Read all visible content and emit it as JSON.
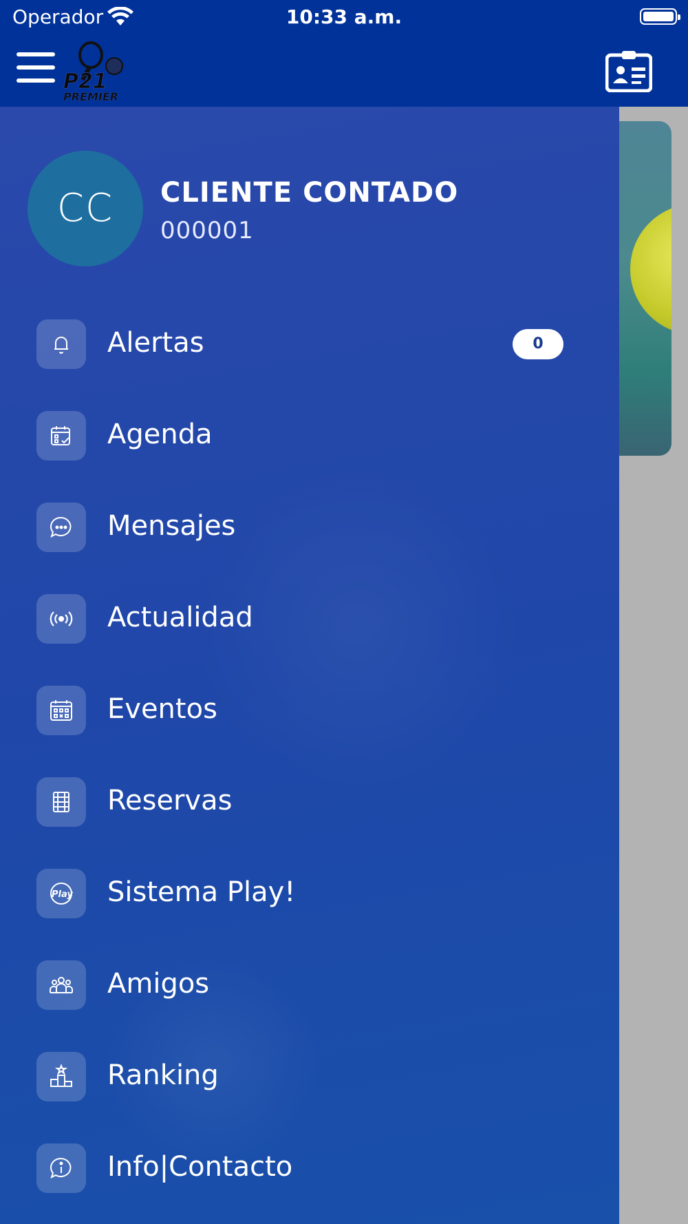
{
  "status_bar": {
    "carrier": "Operador",
    "time": "10:33 a.m.",
    "battery_level": 1.0
  },
  "header": {
    "logo_text": "P21 PREMIER"
  },
  "profile": {
    "initials": "CC",
    "name": "CLIENTE CONTADO",
    "id": "000001"
  },
  "menu": [
    {
      "label": "Alertas",
      "icon": "bell-icon",
      "badge": "0"
    },
    {
      "label": "Agenda",
      "icon": "calendar-check-icon"
    },
    {
      "label": "Mensajes",
      "icon": "chat-bubble-icon"
    },
    {
      "label": "Actualidad",
      "icon": "broadcast-icon"
    },
    {
      "label": "Eventos",
      "icon": "calendar-grid-icon"
    },
    {
      "label": "Reservas",
      "icon": "court-icon"
    },
    {
      "label": "Sistema Play!",
      "icon": "play-badge-icon"
    },
    {
      "label": "Amigos",
      "icon": "friends-icon"
    },
    {
      "label": "Ranking",
      "icon": "podium-icon"
    },
    {
      "label": "Info|Contacto",
      "icon": "info-chat-icon"
    }
  ],
  "colors": {
    "header": "#00329a",
    "drawer": "#1f47a9",
    "avatar": "#1e6fa0",
    "badge_text": "#1a3a8f"
  }
}
